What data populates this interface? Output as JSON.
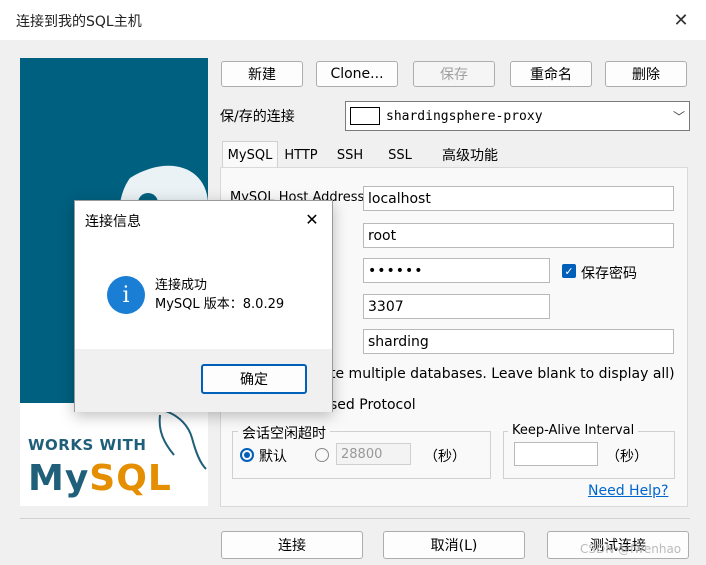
{
  "window": {
    "title": "连接到我的SQL主机",
    "close_glyph": "✕"
  },
  "logo": {
    "works_with": "WORKS WITH",
    "my": "My",
    "sql": "SQL"
  },
  "toolbar": {
    "new_label": "新建",
    "clone_label": "Clone...",
    "save_label": "保存",
    "rename_label": "重命名",
    "delete_label": "删除"
  },
  "saved": {
    "label": "保/存的连接",
    "value": "shardingsphere-proxy",
    "arrow": "﹀"
  },
  "tabs": [
    "MySQL",
    "HTTP",
    "SSH",
    "SSL",
    "高级功能"
  ],
  "form": {
    "host_label": "MySQL Host Address",
    "host_value": "localhost",
    "user_value": "root",
    "password_value": "••••••",
    "save_password_label": "保存密码",
    "port_value": "3307",
    "database_value": "sharding",
    "db_hint": "te multiple databases. Leave blank to display all)",
    "protocol_text": "sed Protocol"
  },
  "session": {
    "legend": "会话空闲超时",
    "default_label": "默认",
    "timeout_value": "28800",
    "seconds": "（秒）"
  },
  "keepalive": {
    "legend": "Keep-Alive Interval",
    "value": "",
    "seconds": "（秒）"
  },
  "help_link": "Need Help?",
  "footer": {
    "connect_label": "连接",
    "cancel_label": "取消(L)",
    "test_label": "测试连接",
    "watermark": "CSDN @fwenhao"
  },
  "dialog": {
    "title": "连接信息",
    "close_glyph": "✕",
    "icon_glyph": "i",
    "line1": "连接成功",
    "line2": "MySQL 版本：8.0.29",
    "ok_label": "确定"
  },
  "colors": {
    "accent": "#005fb8",
    "logo_blue": "#00607f",
    "mysql_orange": "#e48e00"
  }
}
